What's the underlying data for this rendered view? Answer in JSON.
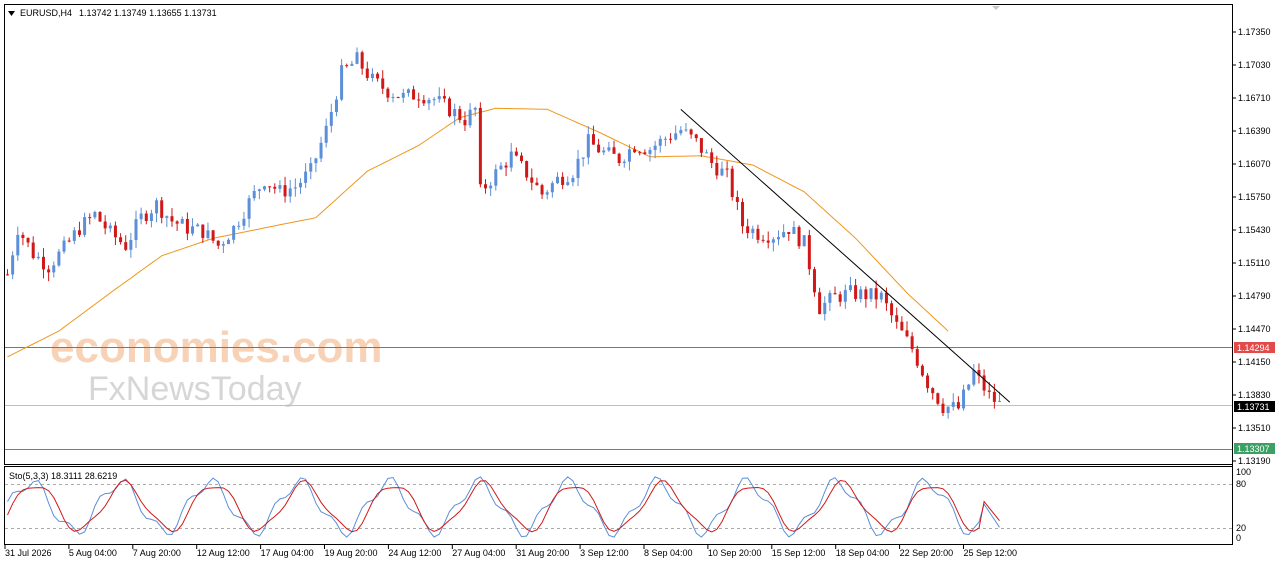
{
  "header": {
    "symbol": "EURUSD,H4",
    "ohlc": "1.13742 1.13749 1.13655 1.13731"
  },
  "watermark": {
    "brand": "economies.com",
    "sub": "FxNewsToday"
  },
  "price_labels": {
    "resistance": "1.14294",
    "current": "1.13731",
    "support": "1.13307"
  },
  "oscillator": {
    "label": "Sto(5,3,3) 18.3111 28.6219",
    "levels": [
      "100",
      "80",
      "20",
      "0"
    ]
  },
  "colors": {
    "bull": "#5b8fd8",
    "bear": "#d01818",
    "ma": "#f0961e",
    "resistance_line": "#e24a4a",
    "support_line": "#3aa064",
    "trendline": "#000000"
  },
  "chart_data": {
    "type": "candlestick",
    "timeframe": "H4",
    "y_ticks": [
      "1.17350",
      "1.17030",
      "1.16710",
      "1.16390",
      "1.16070",
      "1.15750",
      "1.15430",
      "1.15110",
      "1.14790",
      "1.14470",
      "1.14150",
      "1.13830",
      "1.13510",
      "1.13190"
    ],
    "ylim": [
      1.1312,
      1.1762
    ],
    "x_ticks": [
      "31 Jul 2026",
      "5 Aug 04:00",
      "7 Aug 20:00",
      "12 Aug 12:00",
      "17 Aug 04:00",
      "19 Aug 20:00",
      "24 Aug 12:00",
      "27 Aug 04:00",
      "31 Aug 20:00",
      "3 Sep 12:00",
      "8 Sep 04:00",
      "10 Sep 20:00",
      "15 Sep 12:00",
      "18 Sep 04:00",
      "22 Sep 20:00",
      "25 Sep 12:00"
    ],
    "horizontal_levels": [
      1.14294,
      1.13731,
      1.13307
    ],
    "close_path": [
      [
        0,
        1.15
      ],
      [
        2,
        1.1545
      ],
      [
        5,
        1.152
      ],
      [
        8,
        1.1508
      ],
      [
        11,
        1.1525
      ],
      [
        14,
        1.1545
      ],
      [
        17,
        1.1558
      ],
      [
        20,
        1.154
      ],
      [
        23,
        1.1528
      ],
      [
        26,
        1.1555
      ],
      [
        29,
        1.1568
      ],
      [
        32,
        1.1552
      ],
      [
        35,
        1.1545
      ],
      [
        38,
        1.1542
      ],
      [
        41,
        1.1528
      ],
      [
        44,
        1.1545
      ],
      [
        47,
        1.157
      ],
      [
        50,
        1.1592
      ],
      [
        53,
        1.158
      ],
      [
        56,
        1.1585
      ],
      [
        59,
        1.16
      ],
      [
        62,
        1.164
      ],
      [
        65,
        1.1695
      ],
      [
        68,
        1.1708
      ],
      [
        71,
        1.1688
      ],
      [
        74,
        1.1678
      ],
      [
        77,
        1.1672
      ],
      [
        80,
        1.1675
      ],
      [
        83,
        1.167
      ],
      [
        86,
        1.166
      ],
      [
        89,
        1.165
      ],
      [
        91,
        1.166
      ],
      [
        92,
        1.158
      ],
      [
        95,
        1.1598
      ],
      [
        98,
        1.1615
      ],
      [
        101,
        1.1598
      ],
      [
        104,
        1.1578
      ],
      [
        107,
        1.1592
      ],
      [
        110,
        1.16
      ],
      [
        113,
        1.1628
      ],
      [
        116,
        1.1618
      ],
      [
        119,
        1.1612
      ],
      [
        122,
        1.1625
      ],
      [
        125,
        1.1622
      ],
      [
        128,
        1.1632
      ],
      [
        131,
        1.164
      ],
      [
        134,
        1.1628
      ],
      [
        137,
        1.1608
      ],
      [
        140,
        1.1595
      ],
      [
        143,
        1.1548
      ],
      [
        146,
        1.154
      ],
      [
        149,
        1.1538
      ],
      [
        152,
        1.1545
      ],
      [
        155,
        1.153
      ],
      [
        158,
        1.1468
      ],
      [
        161,
        1.1478
      ],
      [
        164,
        1.1482
      ],
      [
        167,
        1.148
      ],
      [
        170,
        1.1478
      ],
      [
        173,
        1.145
      ],
      [
        176,
        1.1428
      ],
      [
        179,
        1.1395
      ],
      [
        182,
        1.1372
      ],
      [
        185,
        1.137
      ],
      [
        188,
        1.1405
      ],
      [
        191,
        1.1382
      ],
      [
        193,
        1.1374
      ]
    ],
    "ma_path": [
      [
        0,
        1.142
      ],
      [
        10,
        1.1445
      ],
      [
        20,
        1.1482
      ],
      [
        30,
        1.1518
      ],
      [
        40,
        1.1535
      ],
      [
        50,
        1.1545
      ],
      [
        60,
        1.1555
      ],
      [
        70,
        1.16
      ],
      [
        80,
        1.1625
      ],
      [
        88,
        1.1652
      ],
      [
        95,
        1.1661
      ],
      [
        105,
        1.166
      ],
      [
        115,
        1.1638
      ],
      [
        125,
        1.1614
      ],
      [
        135,
        1.1615
      ],
      [
        145,
        1.1606
      ],
      [
        155,
        1.158
      ],
      [
        165,
        1.1535
      ],
      [
        175,
        1.1482
      ],
      [
        183,
        1.1445
      ]
    ],
    "trendline": [
      [
        131,
        1.166
      ],
      [
        195,
        1.1376
      ]
    ],
    "stochastic": {
      "k_current": 18.3111,
      "d_current": 28.6219,
      "levels": [
        80,
        20
      ]
    }
  }
}
